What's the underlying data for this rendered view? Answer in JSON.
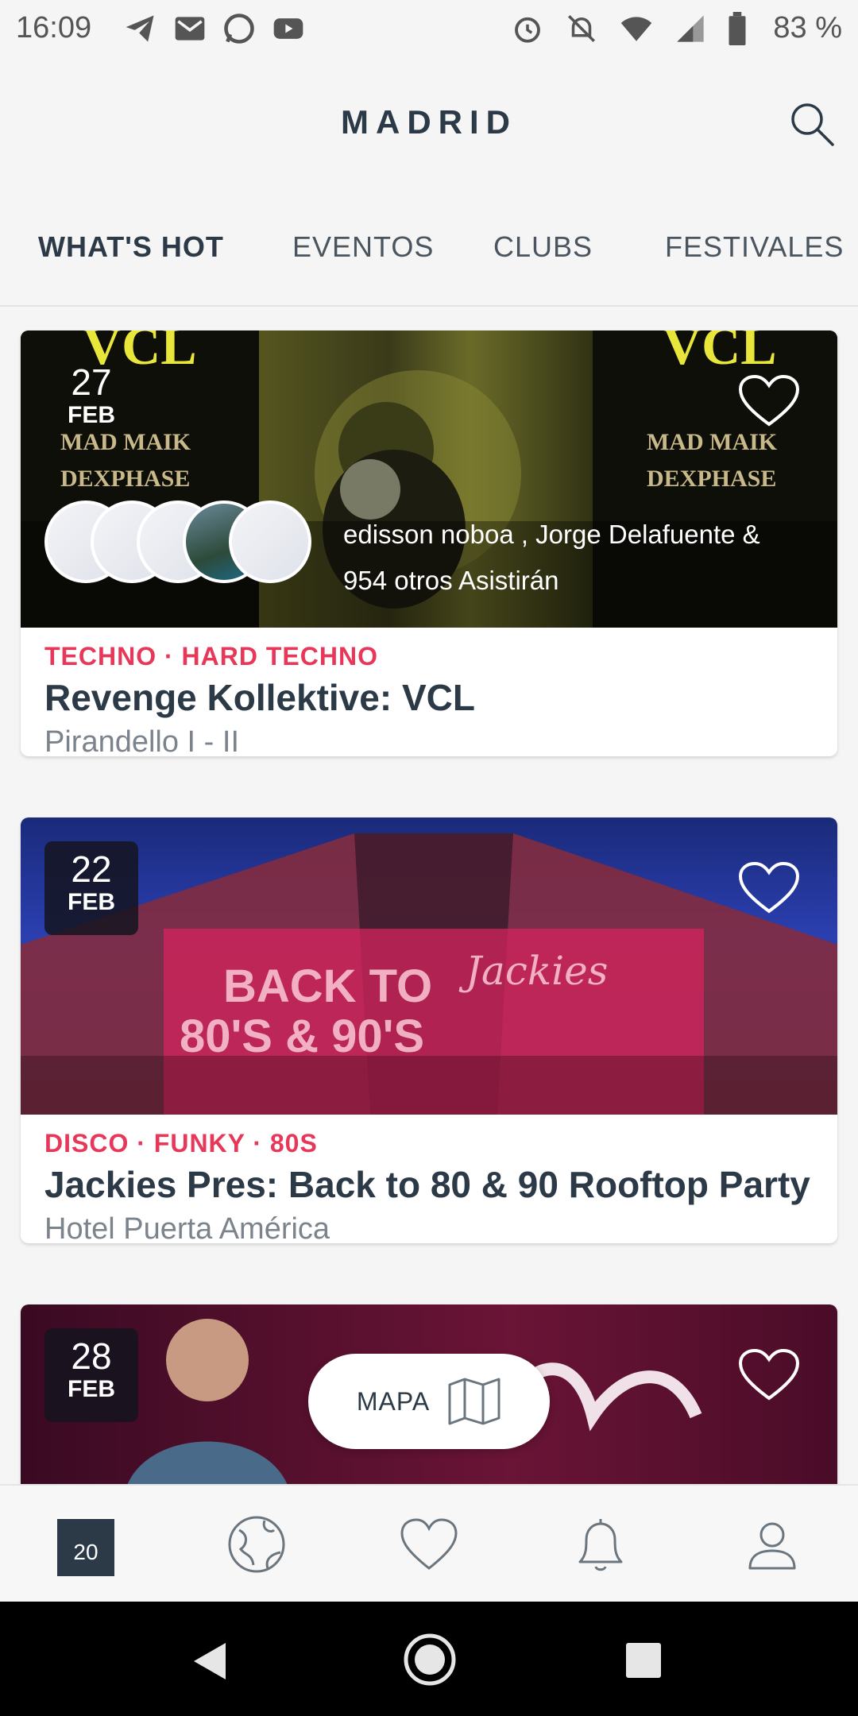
{
  "status_bar": {
    "time": "16:09",
    "battery": "83 %",
    "left_icons": [
      "telegram-icon",
      "gmail-icon",
      "whatsapp-icon",
      "youtube-icon"
    ],
    "right_icons": [
      "alarm-icon",
      "mute-icon",
      "wifi-icon",
      "signal-icon",
      "battery-icon"
    ]
  },
  "header": {
    "title": "MADRID",
    "search_icon": "search-icon"
  },
  "tabs": [
    {
      "label": "WHAT'S HOT",
      "active": true
    },
    {
      "label": "EVENTOS",
      "active": false
    },
    {
      "label": "CLUBS",
      "active": false
    },
    {
      "label": "FESTIVALES",
      "active": false
    }
  ],
  "events": [
    {
      "day": "27",
      "month": "FEB",
      "genres": "TECHNO · HARD TECHNO",
      "title": "Revenge Kollektive: VCL",
      "venue": "Pirandello I - II",
      "attendees_line1": "edisson noboa , Jorge Delafuente &",
      "attendees_line2": "954 otros Asistirán"
    },
    {
      "day": "22",
      "month": "FEB",
      "genres": "DISCO · FUNKY · 80S",
      "title": "Jackies Pres: Back to 80 & 90 Rooftop Party",
      "venue": "Hotel Puerta América"
    },
    {
      "day": "28",
      "month": "FEB"
    }
  ],
  "map_button": {
    "label": "MAPA"
  },
  "bottom_nav": {
    "calendar_day": "20",
    "items": [
      "calendar-icon",
      "globe-icon",
      "heart-icon",
      "bell-icon",
      "profile-icon"
    ]
  },
  "colors": {
    "accent": "#e8385a",
    "text_dark": "#2c3a47",
    "background": "#f5f5f5"
  }
}
